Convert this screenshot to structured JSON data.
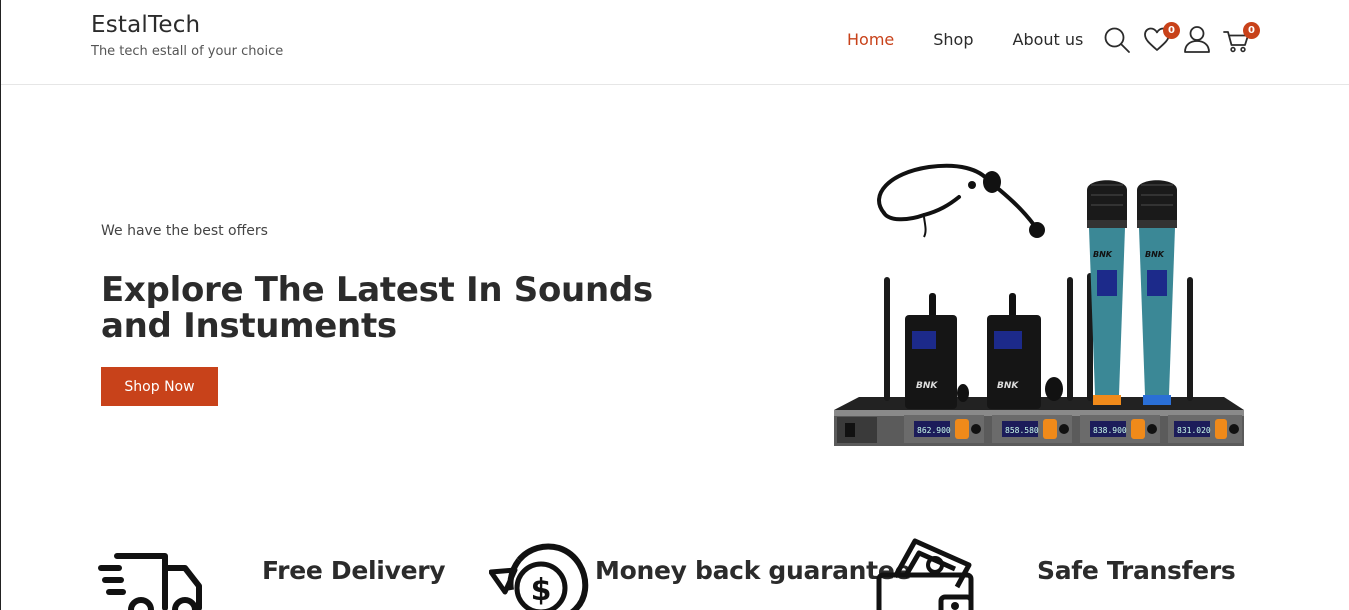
{
  "brand": {
    "name": "EstalTech",
    "tagline": "The tech estall of your choice"
  },
  "nav": {
    "items": [
      {
        "label": "Home",
        "active": true
      },
      {
        "label": "Shop",
        "active": false
      },
      {
        "label": "About us",
        "active": false
      }
    ]
  },
  "header_icons": {
    "search": "search-icon",
    "wishlist": "heart-icon",
    "wishlist_count": "0",
    "account": "user-icon",
    "cart": "cart-icon",
    "cart_count": "0"
  },
  "hero": {
    "kicker": "We have the best offers",
    "title": "Explore The Latest In Sounds and Instuments",
    "cta_label": "Shop Now",
    "product_brand": "BNK",
    "product_readouts": [
      "862.900",
      "858.580",
      "838.900",
      "831.020"
    ]
  },
  "features": [
    {
      "icon": "delivery-truck-icon",
      "title": "Free Delivery"
    },
    {
      "icon": "money-back-icon",
      "title": "Money back guarantee"
    },
    {
      "icon": "wallet-icon",
      "title": "Safe Transfers"
    }
  ],
  "colors": {
    "accent": "#c8421a",
    "text": "#2b2b2b",
    "divider": "#e6e6e6"
  }
}
